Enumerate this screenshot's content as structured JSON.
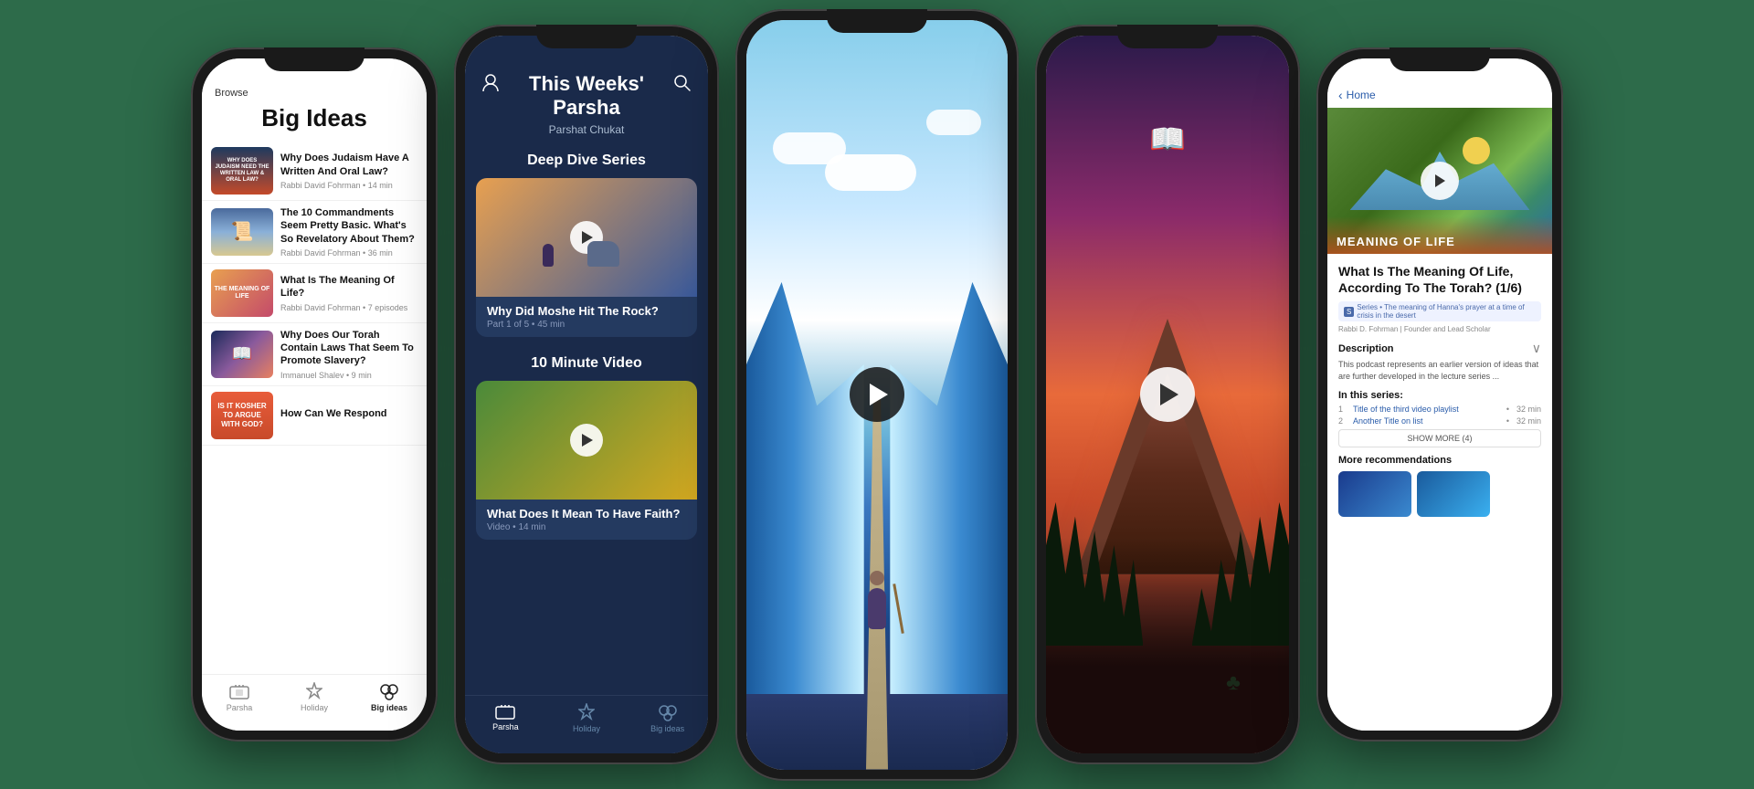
{
  "phone1": {
    "browse_label": "Browse",
    "title": "Big Ideas",
    "items": [
      {
        "title": "Why Does Judaism Have A Written And Oral Law?",
        "meta": "Rabbi David Fohrman • 14 min",
        "thumb_type": "oral-law"
      },
      {
        "title": "The 10 Commandments Seem Pretty Basic. What's So Revelatory About Them?",
        "meta": "Rabbi David Fohrman • 36 min",
        "thumb_type": "commandments"
      },
      {
        "title": "What Is The Meaning Of Life?",
        "meta": "Rabbi David Fohrman • 7 episodes",
        "thumb_type": "meaning"
      },
      {
        "title": "Why Does Our Torah Contain Laws That Seem To Promote Slavery?",
        "meta": "Immanuel Shalev • 9 min",
        "thumb_type": "slavery"
      },
      {
        "title": "How Can We Respond",
        "meta": "",
        "thumb_type": "argue"
      }
    ],
    "nav": {
      "parsha": "Parsha",
      "holiday": "Holiday",
      "big_ideas": "Big ideas",
      "active": "big_ideas"
    }
  },
  "phone2": {
    "header_icon_left": "person-icon",
    "header_icon_right": "search-icon",
    "title": "This Weeks' Parsha",
    "subtitle": "Parshat Chukat",
    "section1": "Deep Dive Series",
    "card1": {
      "title": "Why Did Moshe Hit The Rock?",
      "meta": "Part 1 of 5 • 45 min"
    },
    "section2": "10 Minute Video",
    "card2": {
      "title": "What Does It Mean To Have Faith?",
      "meta": "Video • 14 min"
    },
    "nav": {
      "parsha": "Parsha",
      "holiday": "Holiday",
      "big_ideas": "Big ideas",
      "active": "parsha"
    }
  },
  "phone3": {
    "scene": "parting_of_sea"
  },
  "phone4": {
    "scene": "mountain_with_tablets"
  },
  "phone5": {
    "back_label": "Home",
    "hero_badge": "MEANING OF LIFE",
    "video_title": "What Is The Meaning Of Life, According To The Torah? (1/6)",
    "series_label": "Series • The meaning of Hanna's prayer at a time of crisis in the desert",
    "author": "Rabbi D. Fohrman | Founder and Lead Scholar",
    "description_label": "Description",
    "description_text": "This podcast represents an earlier version of ideas that are further developed in the lecture series ...",
    "in_series_label": "In this series:",
    "series_items": [
      {
        "num": "1",
        "title": "Title of the third video playlist",
        "duration": "32 min"
      },
      {
        "num": "2",
        "title": "Another Title on list",
        "duration": "32 min"
      }
    ],
    "show_more": "SHOW MORE (4)",
    "more_recs_label": "More recommendations"
  },
  "icons": {
    "person": "👤",
    "search": "🔍",
    "parsha": "🕍",
    "holiday": "🥂",
    "big_ideas": "💡",
    "chevron_down": "›",
    "back_arrow": "‹"
  }
}
